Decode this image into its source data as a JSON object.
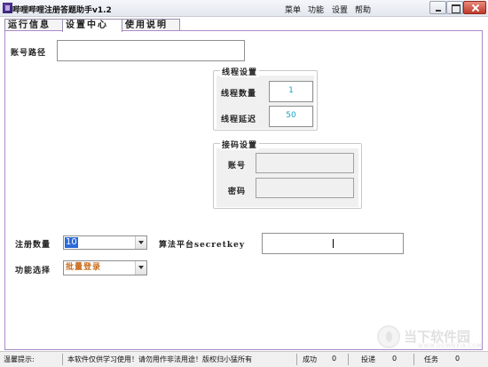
{
  "window": {
    "title": "哔哩哔哩注册答题助手v1.2",
    "menus": [
      "菜单",
      "功能",
      "设置",
      "帮助"
    ]
  },
  "tabs": [
    "运行信息",
    "设置中心",
    "使用说明"
  ],
  "active_tab": "设置中心",
  "account_path": {
    "label": "账号路径",
    "value": ""
  },
  "thread_settings": {
    "title": "线程设置",
    "count_label": "线程数量",
    "count_value": "1",
    "delay_label": "线程延迟",
    "delay_value": "50"
  },
  "captcha_settings": {
    "title": "接码设置",
    "account_label": "账号",
    "account_value": "",
    "password_label": "密码",
    "password_value": ""
  },
  "register_count": {
    "label": "注册数量",
    "value": "10"
  },
  "secret_key": {
    "label": "算法平台secretkey",
    "value": ""
  },
  "function_select": {
    "label": "功能选择",
    "value": "批量登录"
  },
  "statusbar": {
    "tip_label": "温馨提示:",
    "tip_text": "本软件仅供学习使用！请勿用作非法用途！版权归小猛所有",
    "success_label": "成功",
    "success_value": "0",
    "post_label": "投递",
    "post_value": "0",
    "task_label": "任务",
    "task_value": "0"
  },
  "watermark": {
    "text": "当下软件园",
    "sub": "WWW.DOWNXIA.COM"
  },
  "colors": {
    "frame_border": "#a98ac9",
    "value_cyan": "#17a5c0",
    "selected_bg": "#2a6ad8",
    "orange_text": "#c96a1a"
  }
}
